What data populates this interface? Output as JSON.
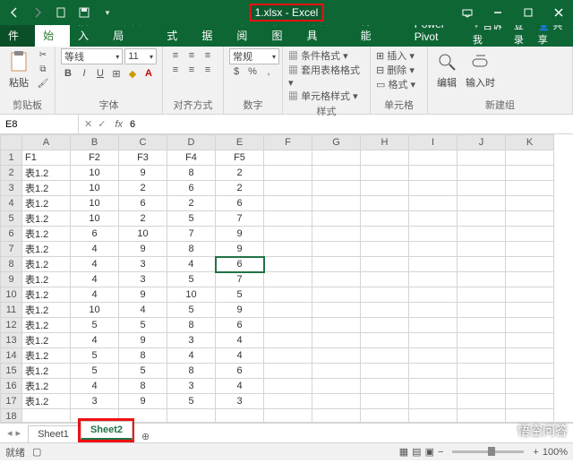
{
  "title": "1.xlsx - Excel",
  "tabs": {
    "file": "文件",
    "home": "开始",
    "insert": "插入",
    "layout": "页面布局",
    "formulas": "公式",
    "data": "数据",
    "review": "审阅",
    "view": "视图",
    "dev": "开发工具",
    "special": "特色功能",
    "pivot": "Power Pivot",
    "tell": "告诉我",
    "login": "登录",
    "share": "共享"
  },
  "ribbon": {
    "clipboard": {
      "paste": "粘贴",
      "label": "剪贴板"
    },
    "font": {
      "name": "等线",
      "size": "11",
      "label": "字体"
    },
    "align": {
      "label": "对齐方式",
      "general": "常规"
    },
    "number": {
      "label": "数字"
    },
    "styles": {
      "cond": "条件格式",
      "table": "套用表格格式",
      "cell": "单元格样式",
      "label": "样式"
    },
    "cells": {
      "insert": "插入",
      "delete": "删除",
      "format": "格式",
      "label": "单元格"
    },
    "editing": {
      "edit": "编辑",
      "input": "输入时",
      "label": "新建组"
    }
  },
  "namebox": "E8",
  "formula": "6",
  "columns": [
    "A",
    "B",
    "C",
    "D",
    "E",
    "F",
    "G",
    "H",
    "I",
    "J",
    "K"
  ],
  "rows": [
    {
      "n": 1,
      "c": [
        "F1",
        "F2",
        "F3",
        "F4",
        "F5",
        "",
        "",
        "",
        "",
        "",
        ""
      ]
    },
    {
      "n": 2,
      "c": [
        "表1.2",
        "10",
        "9",
        "8",
        "2",
        "",
        "",
        "",
        "",
        "",
        ""
      ]
    },
    {
      "n": 3,
      "c": [
        "表1.2",
        "10",
        "2",
        "6",
        "2",
        "",
        "",
        "",
        "",
        "",
        ""
      ]
    },
    {
      "n": 4,
      "c": [
        "表1.2",
        "10",
        "6",
        "2",
        "6",
        "",
        "",
        "",
        "",
        "",
        ""
      ]
    },
    {
      "n": 5,
      "c": [
        "表1.2",
        "10",
        "2",
        "5",
        "7",
        "",
        "",
        "",
        "",
        "",
        ""
      ]
    },
    {
      "n": 6,
      "c": [
        "表1.2",
        "6",
        "10",
        "7",
        "9",
        "",
        "",
        "",
        "",
        "",
        ""
      ]
    },
    {
      "n": 7,
      "c": [
        "表1.2",
        "4",
        "9",
        "8",
        "9",
        "",
        "",
        "",
        "",
        "",
        ""
      ]
    },
    {
      "n": 8,
      "c": [
        "表1.2",
        "4",
        "3",
        "4",
        "6",
        "",
        "",
        "",
        "",
        "",
        ""
      ]
    },
    {
      "n": 9,
      "c": [
        "表1.2",
        "4",
        "3",
        "5",
        "7",
        "",
        "",
        "",
        "",
        "",
        ""
      ]
    },
    {
      "n": 10,
      "c": [
        "表1.2",
        "4",
        "9",
        "10",
        "5",
        "",
        "",
        "",
        "",
        "",
        ""
      ]
    },
    {
      "n": 11,
      "c": [
        "表1.2",
        "10",
        "4",
        "5",
        "9",
        "",
        "",
        "",
        "",
        "",
        ""
      ]
    },
    {
      "n": 12,
      "c": [
        "表1.2",
        "5",
        "5",
        "8",
        "6",
        "",
        "",
        "",
        "",
        "",
        ""
      ]
    },
    {
      "n": 13,
      "c": [
        "表1.2",
        "4",
        "9",
        "3",
        "4",
        "",
        "",
        "",
        "",
        "",
        ""
      ]
    },
    {
      "n": 14,
      "c": [
        "表1.2",
        "5",
        "8",
        "4",
        "4",
        "",
        "",
        "",
        "",
        "",
        ""
      ]
    },
    {
      "n": 15,
      "c": [
        "表1.2",
        "5",
        "5",
        "8",
        "6",
        "",
        "",
        "",
        "",
        "",
        ""
      ]
    },
    {
      "n": 16,
      "c": [
        "表1.2",
        "4",
        "8",
        "3",
        "4",
        "",
        "",
        "",
        "",
        "",
        ""
      ]
    },
    {
      "n": 17,
      "c": [
        "表1.2",
        "3",
        "9",
        "5",
        "3",
        "",
        "",
        "",
        "",
        "",
        ""
      ]
    },
    {
      "n": 18,
      "c": [
        "",
        "",
        "",
        "",
        "",
        "",
        "",
        "",
        "",
        "",
        ""
      ]
    }
  ],
  "selected": {
    "row": 8,
    "col": 5
  },
  "sheets": {
    "s1": "Sheet1",
    "s2": "Sheet2"
  },
  "status": {
    "ready": "就绪",
    "zoom": "100%"
  },
  "watermark": "悟空问答"
}
